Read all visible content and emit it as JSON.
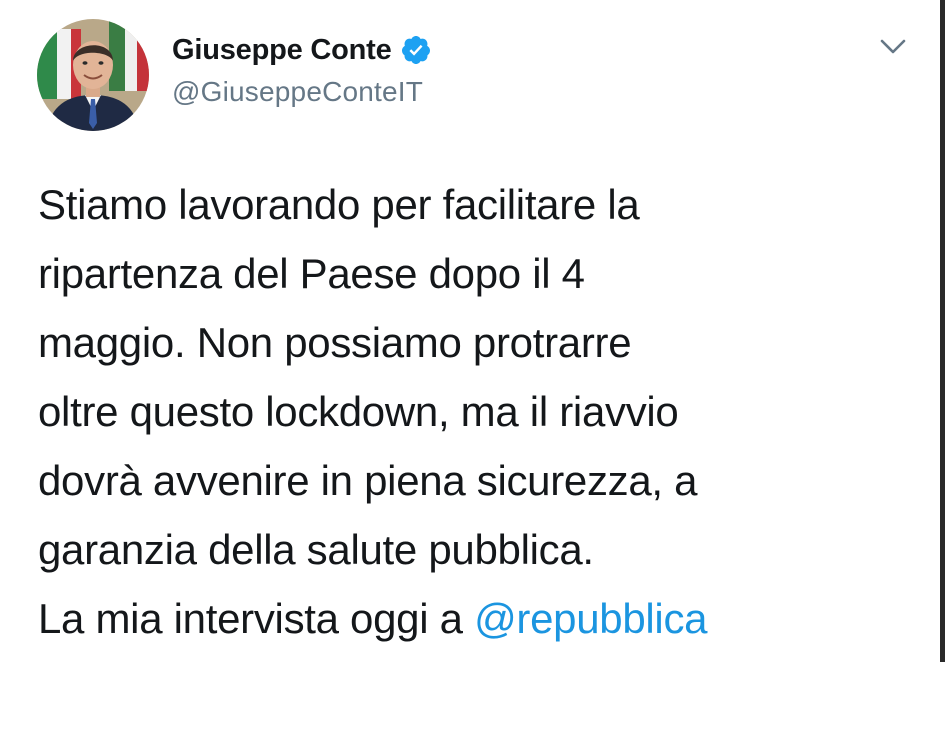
{
  "author": {
    "display_name": "Giuseppe Conte",
    "handle": "@GiuseppeConteIT",
    "verified": true,
    "avatar_icon": "profile-photo"
  },
  "menu": {
    "icon": "chevron-down-icon"
  },
  "tweet": {
    "lines": [
      "Stiamo lavorando per facilitare la",
      "ripartenza del Paese dopo il 4",
      "maggio. Non possiamo protrarre",
      "oltre questo lockdown, ma il riavvio",
      "dovrà avvenire in piena sicurezza, a",
      "garanzia della salute pubblica."
    ],
    "last_line_prefix": "La mia intervista oggi a ",
    "mention": "@repubblica"
  },
  "colors": {
    "text": "#14171a",
    "handle": "#657786",
    "link": "#1b95e0",
    "verified": "#1da1f2"
  }
}
